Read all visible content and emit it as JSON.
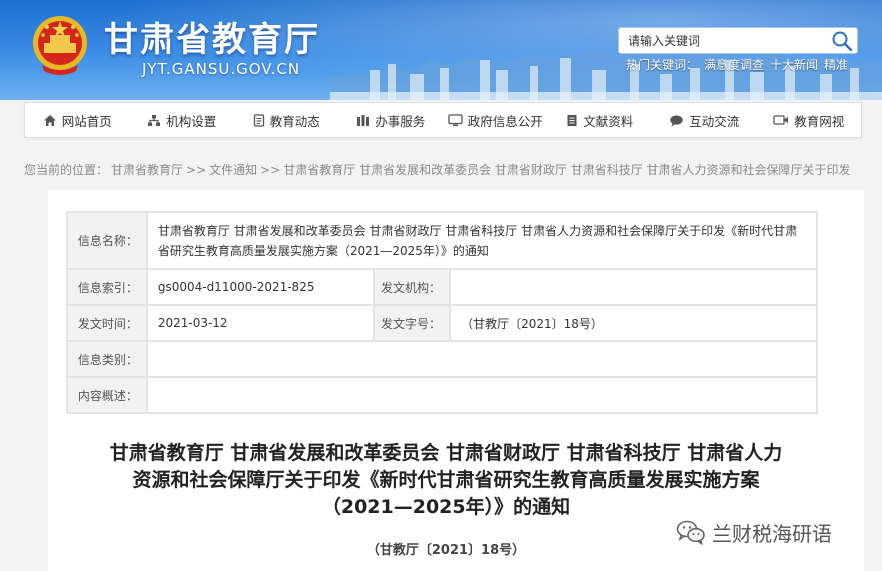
{
  "header": {
    "title": "甘肃省教育厅",
    "domain": "JYT.GANSU.GOV.CN",
    "search_placeholder": "请输入关键词",
    "hotwords_label": "热门关键词：",
    "hotwords": [
      "满意度调查",
      "十大新闻",
      "精准"
    ]
  },
  "nav": {
    "items": [
      {
        "label": "网站首页",
        "icon": "home-icon"
      },
      {
        "label": "机构设置",
        "icon": "org-chart-icon"
      },
      {
        "label": "教育动态",
        "icon": "document-icon"
      },
      {
        "label": "办事服务",
        "icon": "service-icon"
      },
      {
        "label": "政府信息公开",
        "icon": "monitor-icon"
      },
      {
        "label": "文献资料",
        "icon": "file-icon"
      },
      {
        "label": "互动交流",
        "icon": "chat-icon"
      },
      {
        "label": "教育网视",
        "icon": "video-icon"
      }
    ]
  },
  "breadcrumb": {
    "prefix": "您当前的位置：",
    "items": [
      "甘肃省教育厅",
      ">>",
      "文件通知",
      ">>",
      "甘肃省教育厅 甘肃省发展和改革委员会 甘肃省财政厅 甘肃省科技厅 甘肃省人力资源和社会保障厅关于印发"
    ]
  },
  "info": {
    "name_label": "信息名称：",
    "name_value": "甘肃省教育厅 甘肃省发展和改革委员会 甘肃省财政厅 甘肃省科技厅 甘肃省人力资源和社会保障厅关于印发《新时代甘肃省研究生教育高质量发展实施方案（2021—2025年）》的通知",
    "index_label": "信息索引：",
    "index_value": "gs0004-d11000-2021-825",
    "org_label": "发文机构：",
    "org_value": "",
    "date_label": "发文时间：",
    "date_value": "2021-03-12",
    "docno_label": "发文字号：",
    "docno_value": "（甘教厅〔2021〕18号）",
    "category_label": "信息类别：",
    "category_value": "",
    "summary_label": "内容概述：",
    "summary_value": ""
  },
  "article": {
    "title_line1": "甘肃省教育厅 甘肃省发展和改革委员会 甘肃省财政厅 甘肃省科技厅 甘肃省人力",
    "title_line2": "资源和社会保障厅关于印发《新时代甘肃省研究生教育高质量发展实施方案",
    "title_line3": "（2021—2025年）》的通知",
    "doc_number": "（甘教厅〔2021〕18号）"
  },
  "watermark": {
    "text": "兰财税海研语"
  }
}
